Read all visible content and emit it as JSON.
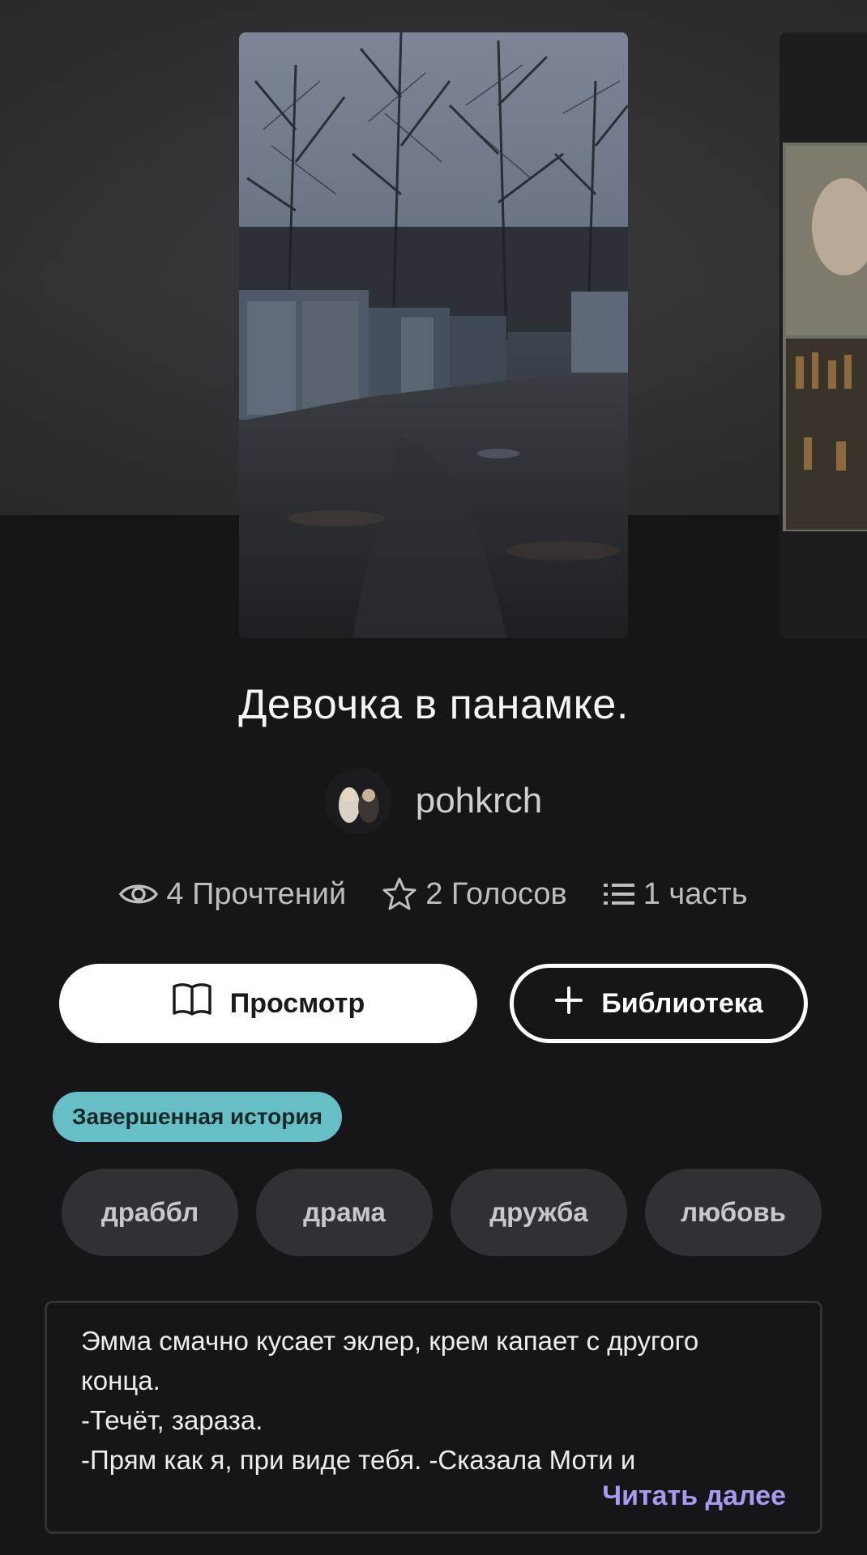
{
  "story": {
    "title": "Девочка в панамке.",
    "author": "pohkrch",
    "stats": {
      "reads": "4 Прочтений",
      "votes": "2 Голосов",
      "parts": "1 часть"
    },
    "status_badge": "Завершенная история",
    "tags": [
      "драббл",
      "драма",
      "дружба",
      "любовь"
    ],
    "description_lines": [
      "Эмма смачно кусает эклер, крем капает с другого",
      "конца.",
      "-Течёт, зараза.",
      "-Прям как я, при виде тебя. -Сказала Моти и"
    ],
    "read_more": "Читать далее"
  },
  "actions": {
    "read_label": "Просмотр",
    "library_label": "Библиотека"
  },
  "icons": {
    "reads": "eye-icon",
    "votes": "star-icon",
    "parts": "list-icon",
    "read": "book-icon",
    "library": "plus-icon"
  },
  "colors": {
    "background": "#161518",
    "badge": "#66bfc4",
    "read_more": "#a99af0",
    "tag_bg": "#313034"
  }
}
